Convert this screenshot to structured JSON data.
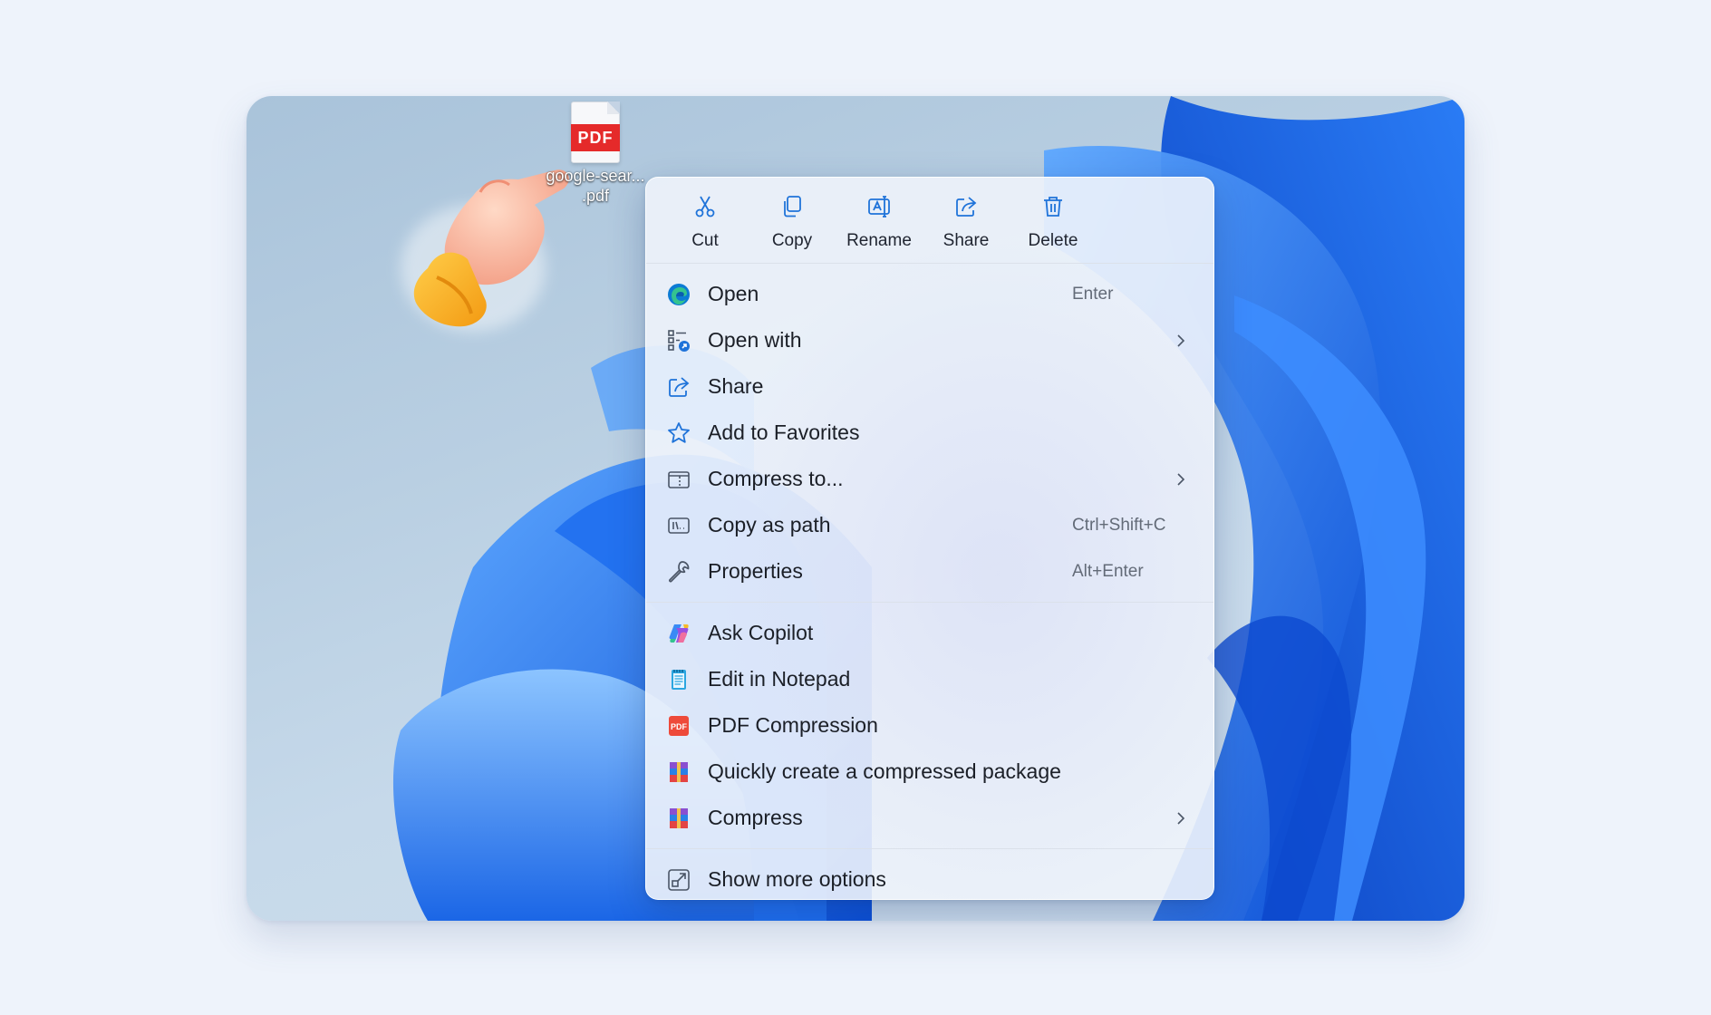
{
  "desktop": {
    "file": {
      "badge": "PDF",
      "name_line1": "google-sear...",
      "name_line2": ".pdf"
    }
  },
  "context_menu": {
    "quick_actions": [
      {
        "label": "Cut",
        "icon": "scissors-icon"
      },
      {
        "label": "Copy",
        "icon": "copy-icon"
      },
      {
        "label": "Rename",
        "icon": "rename-icon"
      },
      {
        "label": "Share",
        "icon": "share-icon"
      },
      {
        "label": "Delete",
        "icon": "trash-icon"
      }
    ],
    "items": [
      {
        "label": "Open",
        "shortcut": "Enter",
        "icon": "edge-icon"
      },
      {
        "label": "Open with",
        "shortcut": "",
        "icon": "open-with-icon",
        "submenu": true
      },
      {
        "label": "Share",
        "shortcut": "",
        "icon": "share-icon"
      },
      {
        "label": "Add to Favorites",
        "shortcut": "",
        "icon": "star-icon"
      },
      {
        "label": "Compress to...",
        "shortcut": "",
        "icon": "zip-folder-icon",
        "submenu": true
      },
      {
        "label": "Copy as path",
        "shortcut": "Ctrl+Shift+C",
        "icon": "path-icon"
      },
      {
        "label": "Properties",
        "shortcut": "Alt+Enter",
        "icon": "wrench-icon"
      }
    ],
    "apps": [
      {
        "label": "Ask Copilot",
        "icon": "copilot-icon"
      },
      {
        "label": "Edit in Notepad",
        "icon": "notepad-icon"
      },
      {
        "label": "PDF Compression",
        "icon": "pdf-compression-icon"
      },
      {
        "label": "Quickly create a compressed package",
        "icon": "winrar-icon"
      },
      {
        "label": "Compress",
        "icon": "winrar-icon",
        "submenu": true
      }
    ],
    "more": {
      "label": "Show more options",
      "icon": "expand-icon"
    }
  },
  "colors": {
    "accent": "#1f73d9",
    "pdf_red": "#e52a2a",
    "wallpaper_blue": "#1565e8"
  }
}
